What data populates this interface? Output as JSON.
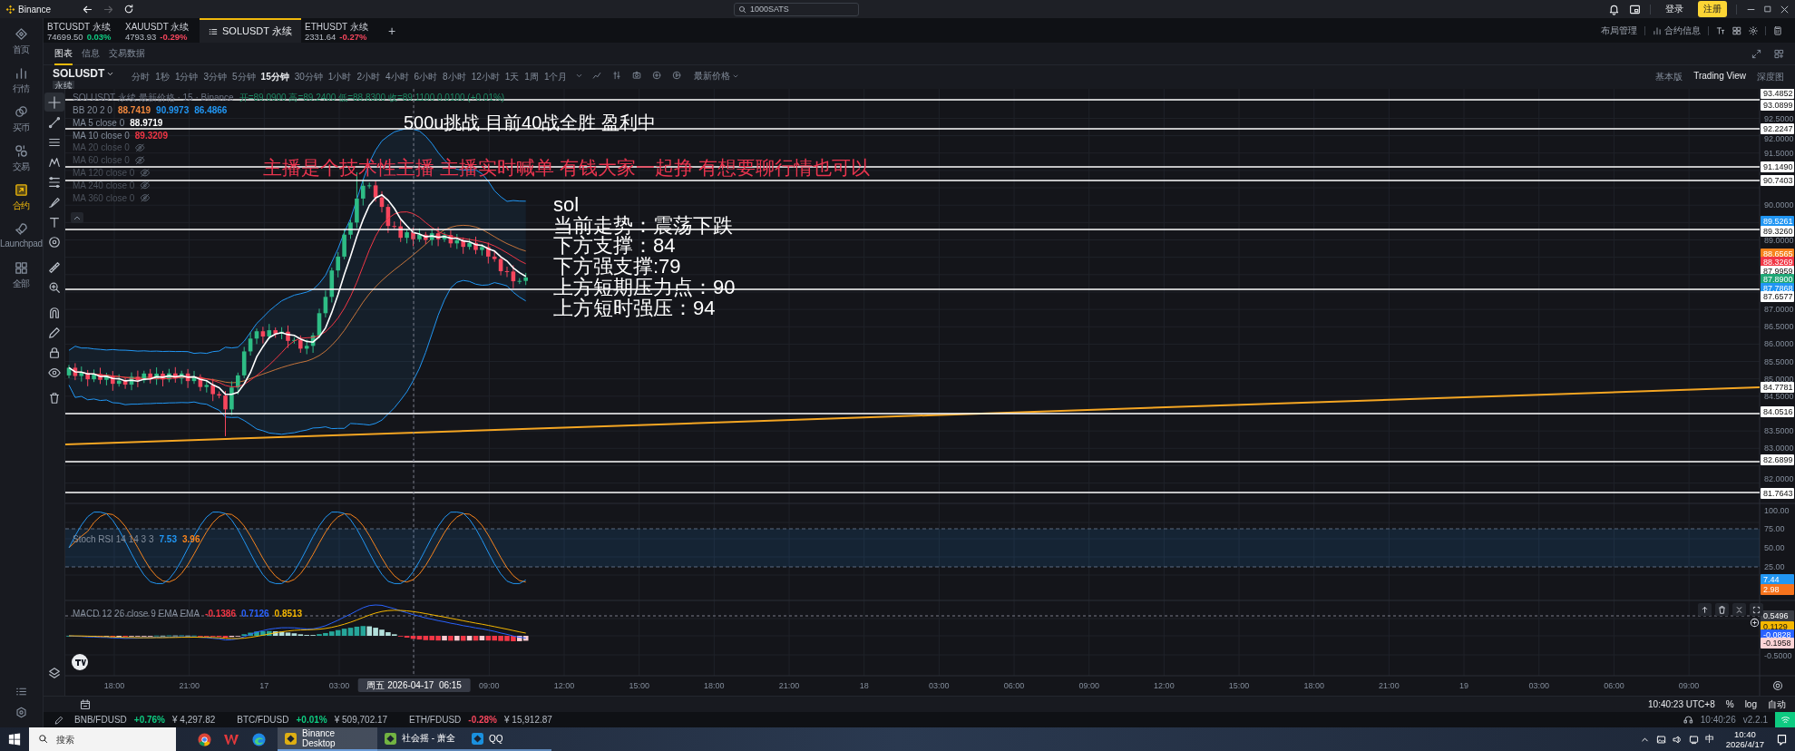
{
  "window": {
    "app_name": "Binance",
    "forward_enabled": false,
    "search": {
      "placeholder": "1000SATS"
    },
    "login": "登录",
    "register": "注册"
  },
  "sidebar": {
    "items": [
      {
        "label": "首页",
        "selected": false
      },
      {
        "label": "行情",
        "selected": false
      },
      {
        "label": "买币",
        "selected": false
      },
      {
        "label": "交易",
        "selected": false
      },
      {
        "label": "合约",
        "selected": true
      },
      {
        "label": "Launchpad",
        "selected": false
      },
      {
        "label": "全部",
        "selected": false
      }
    ]
  },
  "market_tabs": [
    {
      "symbol": "BTCUSDT 永续",
      "price": "74699.50",
      "change": "0.03%",
      "color": "#0ecb81",
      "selected": false
    },
    {
      "symbol": "XAUUSDT 永续",
      "price": "4793.93",
      "change": "-0.29%",
      "color": "#f6465d",
      "selected": false
    },
    {
      "symbol": "SOLUSDT 永续",
      "selected": true
    },
    {
      "symbol": "ETHUSDT 永续",
      "price": "2331.64",
      "change": "-0.27%",
      "color": "#f6465d",
      "selected": false
    }
  ],
  "add_tab": "+",
  "header_links": [
    "布局管理",
    "合约信息"
  ],
  "view_tabs": [
    {
      "label": "图表",
      "selected": true
    },
    {
      "label": "信息",
      "selected": false
    },
    {
      "label": "交易数据",
      "selected": false
    }
  ],
  "toolbar": {
    "symbol": "SOLUSDT",
    "contract_type": "永续",
    "intervals": [
      {
        "label": "分时",
        "selected": false
      },
      {
        "label": "1秒",
        "selected": false
      },
      {
        "label": "1分钟",
        "selected": false
      },
      {
        "label": "3分钟",
        "selected": false
      },
      {
        "label": "5分钟",
        "selected": false
      },
      {
        "label": "15分钟",
        "selected": true
      },
      {
        "label": "30分钟",
        "selected": false
      },
      {
        "label": "1小时",
        "selected": false
      },
      {
        "label": "2小时",
        "selected": false
      },
      {
        "label": "4小时",
        "selected": false
      },
      {
        "label": "6小时",
        "selected": false
      },
      {
        "label": "8小时",
        "selected": false
      },
      {
        "label": "12小时",
        "selected": false
      },
      {
        "label": "1天",
        "selected": false
      },
      {
        "label": "1周",
        "selected": false
      },
      {
        "label": "1个月",
        "selected": false
      }
    ],
    "price_source": "最新价格",
    "chart_modes": [
      {
        "label": "基本版",
        "selected": false
      },
      {
        "label": "Trading View",
        "selected": true
      },
      {
        "label": "深度图",
        "selected": false
      }
    ]
  },
  "drawing_tools": [
    {
      "selected": true
    },
    {
      "selected": false
    },
    {
      "selected": false
    },
    {
      "selected": false
    },
    {
      "selected": false
    },
    {
      "selected": false
    },
    {
      "selected": false
    },
    {
      "selected": false
    },
    {
      "selected": false
    },
    {
      "selected": false
    },
    {
      "selected": false
    },
    {
      "selected": false
    },
    {
      "selected": false
    },
    {
      "selected": false
    },
    {
      "selected": false
    }
  ],
  "chart": {
    "legend": {
      "title": "SOLUSDT 永续 最新价格 · 15 · Binance",
      "ohlc": "开=89.0900 高=89.2400 低=88.8300 收=89.1100 0.0100 (+0.01%)"
    },
    "indicators": [
      {
        "label": "BB 20 2 0",
        "visible": true,
        "values": [
          {
            "text": "88.7419",
            "color": "#f0883e"
          },
          {
            "text": "90.9973",
            "color": "#2196f3"
          },
          {
            "text": "86.4866",
            "color": "#2196f3"
          }
        ]
      },
      {
        "label": "MA 5 close 0",
        "visible": true,
        "values": [
          {
            "text": "88.9719",
            "color": "#ffffff"
          }
        ]
      },
      {
        "label": "MA 10 close 0",
        "visible": true,
        "values": [
          {
            "text": "89.3209",
            "color": "#f23645"
          }
        ]
      },
      {
        "label": "MA 20 close 0",
        "visible": false
      },
      {
        "label": "MA 60 close 0",
        "visible": false
      },
      {
        "label": "MA 120 close 0",
        "visible": false
      },
      {
        "label": "MA 240 close 0",
        "visible": false
      },
      {
        "label": "MA 360 close 0",
        "visible": false
      }
    ],
    "annotations": [
      {
        "color": "#ffffff",
        "lines": [
          "500u挑战 目前40战全胜 盈利中"
        ]
      },
      {
        "color": "#e8344e",
        "lines": [
          "主播是个技术性主播 主播实时喊单 有钱大家一起挣 有想要聊行情也可以"
        ]
      },
      {
        "color": "#ffffff",
        "lines": [
          "sol",
          "当前走势：震荡下跌",
          "下方支撑：84",
          "下方强支撑:79",
          "上方短期压力点：90",
          "上方短时强压：94"
        ]
      }
    ],
    "price_ticks": [
      "92.5000",
      "92.0000",
      "91.5000",
      "90.0000",
      "89.0000",
      "87.0000",
      "86.5000",
      "86.0000",
      "85.5000",
      "85.0000",
      "84.5000",
      "83.5000",
      "83.0000",
      "82.0000"
    ],
    "price_labels": [
      {
        "text": "93.4852",
        "kind": "tag",
        "color": "#ffffff"
      },
      {
        "text": "93.0899",
        "kind": "line"
      },
      {
        "text": "92.2247",
        "kind": "line"
      },
      {
        "text": "91.1490",
        "kind": "line"
      },
      {
        "text": "90.7403",
        "kind": "line"
      },
      {
        "text": "89.5261",
        "kind": "tag",
        "color": "#2196f3"
      },
      {
        "text": "89.3260",
        "kind": "line"
      },
      {
        "text": "88.6565",
        "kind": "tag",
        "color": "#f7831c"
      },
      {
        "text": "88.3269",
        "kind": "tag",
        "color": "#f23645"
      },
      {
        "text": "87.9959",
        "kind": "tag",
        "color": "#ffffff"
      },
      {
        "text": "87.8900",
        "kind": "tag",
        "color": "#1fa776"
      },
      {
        "text": "87.7868",
        "kind": "tag",
        "color": "#2196f3"
      },
      {
        "text": "87.6577",
        "kind": "line"
      },
      {
        "text": "84.7781",
        "kind": "trend"
      },
      {
        "text": "84.0516",
        "kind": "line"
      },
      {
        "text": "82.6899",
        "kind": "line"
      },
      {
        "text": "81.7643",
        "kind": "line"
      }
    ],
    "stoch_rsi": {
      "legend": "Stoch RSI 14 14 3 3",
      "values": [
        {
          "text": "7.53",
          "color": "#2196f3"
        },
        {
          "text": "3.96",
          "color": "#f7831c"
        }
      ],
      "ticks": [
        "100.00",
        "75.00",
        "50.00",
        "25.00"
      ],
      "labels": [
        {
          "text": "7.44",
          "color": "#2196f3"
        },
        {
          "text": "2.98",
          "color": "#f7731c"
        }
      ]
    },
    "macd": {
      "legend": "MACD 12 26 close 9 EMA EMA",
      "values": [
        {
          "text": "-0.1386",
          "color": "#f23645"
        },
        {
          "text": "0.7126",
          "color": "#2962ff"
        },
        {
          "text": "0.8513",
          "color": "#f5b700"
        }
      ],
      "ticks": [
        "-0.5000"
      ],
      "labels": [
        {
          "text": "0.5496",
          "color": "#3a3d44"
        },
        {
          "text": "0.1129",
          "color": "#f5b700"
        },
        {
          "text": "-0.0828",
          "color": "#2962ff"
        },
        {
          "text": "-0.1958",
          "color": "#fcd4d6"
        }
      ]
    },
    "time_axis": [
      {
        "text": "18:00",
        "kind": "tick"
      },
      {
        "text": "21:00",
        "kind": "tick"
      },
      {
        "text": "17",
        "kind": "tick"
      },
      {
        "text": "03:00",
        "kind": "tick"
      },
      {
        "text": "周五 2026-04-17  06:15",
        "kind": "crosshair"
      },
      {
        "text": "09:00",
        "kind": "tick"
      },
      {
        "text": "12:00",
        "kind": "tick"
      },
      {
        "text": "15:00",
        "kind": "tick"
      },
      {
        "text": "18:00",
        "kind": "tick"
      },
      {
        "text": "21:00",
        "kind": "tick"
      },
      {
        "text": "18",
        "kind": "tick"
      },
      {
        "text": "03:00",
        "kind": "tick"
      },
      {
        "text": "06:00",
        "kind": "tick"
      },
      {
        "text": "09:00",
        "kind": "tick"
      },
      {
        "text": "12:00",
        "kind": "tick"
      },
      {
        "text": "15:00",
        "kind": "tick"
      },
      {
        "text": "18:00",
        "kind": "tick"
      },
      {
        "text": "21:00",
        "kind": "tick"
      },
      {
        "text": "19",
        "kind": "tick"
      },
      {
        "text": "03:00",
        "kind": "tick"
      },
      {
        "text": "06:00",
        "kind": "tick"
      },
      {
        "text": "09:00",
        "kind": "tick"
      }
    ]
  },
  "status": {
    "clock": "10:40:23 UTC+8",
    "scale_options": [
      "%",
      "log",
      "自动"
    ]
  },
  "tickers": [
    {
      "pair": "BNB/FDUSD",
      "change": "+0.76%",
      "color": "#0ecb81",
      "price": "¥ 4,297.82"
    },
    {
      "pair": "BTC/FDUSD",
      "change": "+0.01%",
      "color": "#0ecb81",
      "price": "¥ 509,702.17"
    },
    {
      "pair": "ETH/FDUSD",
      "change": "-0.28%",
      "color": "#f6465d",
      "price": "¥ 15,912.87"
    }
  ],
  "app_status": {
    "time": "10:40:26",
    "version": "v2.2.1"
  },
  "taskbar": {
    "search": {
      "placeholder": "搜索"
    },
    "apps": [
      {
        "label": "Binance Desktop",
        "selected": true
      },
      {
        "label": "社会摇 - 萧全",
        "selected": false
      },
      {
        "label": "QQ",
        "selected": false
      }
    ],
    "ime": "中",
    "time": "10:40",
    "date": "2026/4/17"
  }
}
